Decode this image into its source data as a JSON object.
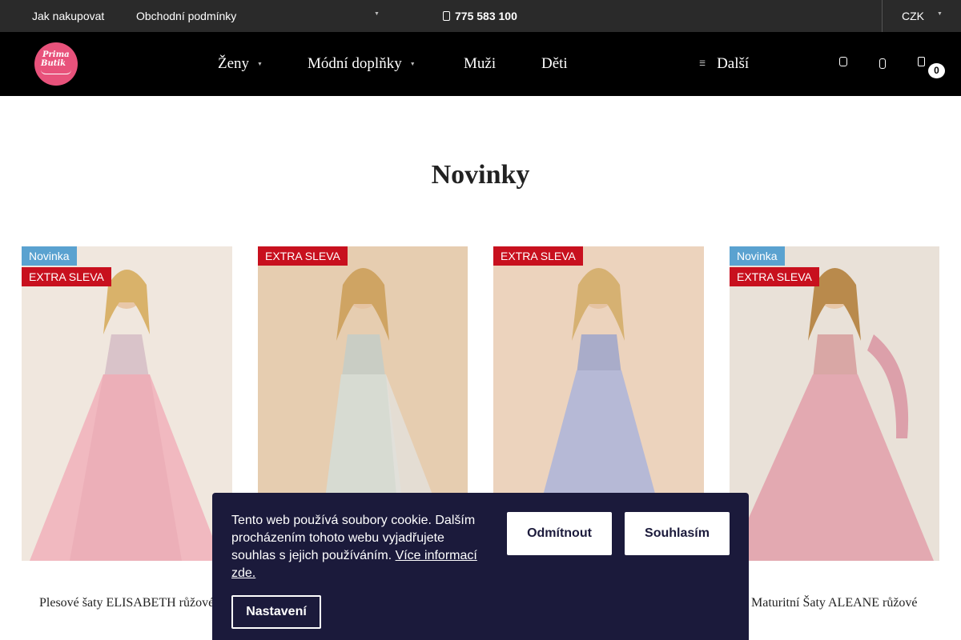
{
  "topbar": {
    "link_how_to_buy": "Jak nakupovat",
    "link_terms": "Obchodní podmínky",
    "phone": "775 583 100",
    "currency": "CZK"
  },
  "nav": {
    "logo_line1": "Prima",
    "logo_line2": "Butik",
    "items": [
      {
        "label": "Ženy"
      },
      {
        "label": "Módní doplňky"
      },
      {
        "label": "Muži"
      },
      {
        "label": "Děti"
      }
    ],
    "more_label": "Další",
    "cart_count": "0"
  },
  "section": {
    "title": "Novinky"
  },
  "products": [
    {
      "name": "Plesové šaty ELISABETH růžové",
      "badges": [
        "Novinka",
        "EXTRA SLEVA"
      ],
      "dress_color": "#f1b9c0"
    },
    {
      "name": "",
      "badges": [
        "EXTRA SLEVA"
      ],
      "dress_color": "#d7dbd2"
    },
    {
      "name": "",
      "badges": [
        "EXTRA SLEVA"
      ],
      "dress_color": "#b6b9d6"
    },
    {
      "name": "Maturitní Šaty ALEANE růžové",
      "badges": [
        "Novinka",
        "EXTRA SLEVA"
      ],
      "dress_color": "#e3a9b1"
    }
  ],
  "cookie": {
    "text": "Tento web používá soubory cookie. Dalším procházením tohoto webu vyjadřujete souhlas s jejich používáním.",
    "more_link": "Více informací zde.",
    "decline": "Odmítnout",
    "accept": "Souhlasím",
    "settings": "Nastavení"
  },
  "colors": {
    "topbar_bg": "#2a2a2a",
    "nav_bg": "#000000",
    "logo_pink": "#e8527b",
    "badge_new": "#5aa2d0",
    "badge_sale": "#c8101e",
    "cookie_bg": "#1b1a3b"
  }
}
